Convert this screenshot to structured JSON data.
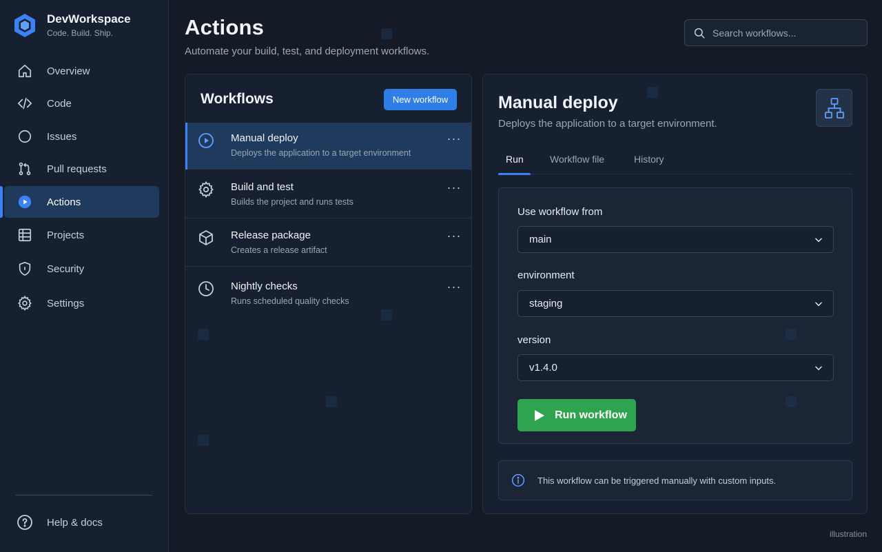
{
  "brand": {
    "name": "DevWorkspace",
    "tagline": "Code. Build. Ship."
  },
  "sidebar": {
    "items": [
      {
        "label": "Overview",
        "icon": "home-icon"
      },
      {
        "label": "Code",
        "icon": "code-icon"
      },
      {
        "label": "Issues",
        "icon": "circle-icon"
      },
      {
        "label": "Pull requests",
        "icon": "pull-request-icon"
      },
      {
        "label": "Actions",
        "icon": "play-circle-icon",
        "active": true
      },
      {
        "label": "Projects",
        "icon": "table-icon"
      },
      {
        "label": "Security",
        "icon": "shield-icon"
      },
      {
        "label": "Settings",
        "icon": "gear-icon"
      }
    ],
    "help_label": "Help & docs"
  },
  "header": {
    "title": "Actions",
    "subtitle": "Automate your build, test, and deployment workflows."
  },
  "search": {
    "placeholder": "Search workflows..."
  },
  "workflows": {
    "title": "Workflows",
    "new_button": "New workflow",
    "items": [
      {
        "name": "Manual deploy",
        "desc": "Deploys the application to a target environment",
        "icon": "play-circle-icon",
        "active": true
      },
      {
        "name": "Build and test",
        "desc": "Builds the project and runs tests",
        "icon": "gear-icon"
      },
      {
        "name": "Release package",
        "desc": "Creates a release artifact",
        "icon": "package-icon"
      },
      {
        "name": "Nightly checks",
        "desc": "Runs scheduled quality checks",
        "icon": "clock-icon"
      }
    ]
  },
  "detail": {
    "title": "Manual deploy",
    "subtitle": "Deploys the application to a target environment.",
    "tabs": [
      "Run",
      "Workflow file",
      "History"
    ],
    "active_tab": "Run",
    "form": {
      "workflow_from_label": "Use workflow from",
      "workflow_from_value": "main",
      "environment_label": "environment",
      "environment_value": "staging",
      "version_label": "version",
      "version_value": "v1.4.0",
      "run_button": "Run workflow"
    },
    "info": "This workflow can be triggered manually with custom inputs."
  },
  "footer_note": "illustration",
  "colors": {
    "accent": "#3b82f6",
    "primary_button": "#2f7ee8",
    "run_button": "#2ea44f",
    "background": "#141b26",
    "panel": "#172030"
  }
}
